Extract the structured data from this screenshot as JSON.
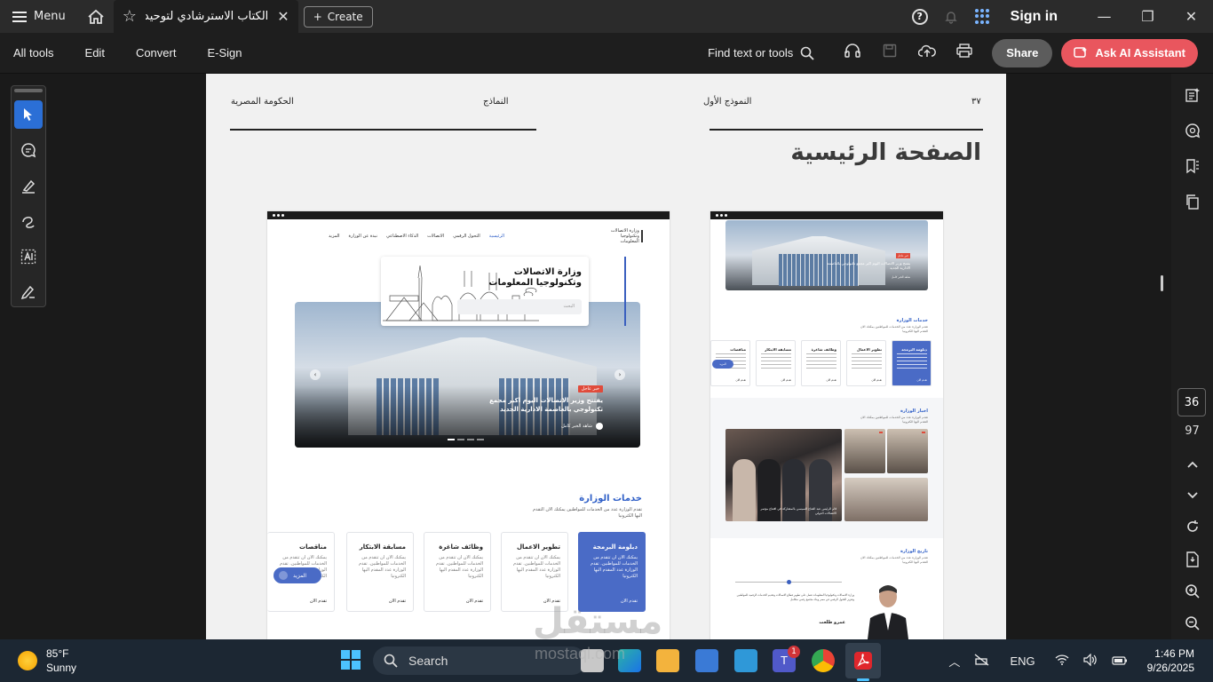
{
  "titlebar": {
    "menu_label": "Menu",
    "tab_title": "الكتاب الاسترشادي لتوحيد ال...",
    "create_label": "Create",
    "help_label": "?",
    "signin_label": "Sign in",
    "minimize": "—",
    "restore": "❐",
    "close": "✕"
  },
  "toolbar": {
    "items": [
      "All tools",
      "Edit",
      "Convert",
      "E-Sign"
    ],
    "find_label": "Find text or tools",
    "share_label": "Share",
    "ai_label": "Ask AI Assistant"
  },
  "document": {
    "header": {
      "page_no": "٣٧",
      "model_label": "النموذج الأول",
      "models_label": "النماذج",
      "gov_label": "الحكومة المصرية"
    },
    "page_title": "الصفحة الرئيسية",
    "mock_a": {
      "nav": [
        "الرئيسية",
        "التحول الرقمي",
        "الاتصالات",
        "الذكاء الاصطناعي",
        "نبذة عن الوزارة",
        "المزيد"
      ],
      "logo_text": "وزارة الاتصالات وتكنولوجيا المعلومات",
      "hero_title_1": "وزارة الاتصالات",
      "hero_title_2": "وتكنولوجيا المعلومات",
      "search_placeholder": "البحث",
      "badge": "خبر عاجل",
      "headline": "يفتتح وزير الاتصالات اليوم اكبر مجمع تكنولوجي بالعاصمة الادارية الجديد",
      "more_link": "شاهد الخبر كامل",
      "services_title": "خدمات الوزارة",
      "services_sub": "تقدم الوزارة عدد من الخدمات للمواطنين يمكنك الان التقدم اليها الكترونيا",
      "services": [
        {
          "title": "دبلومة البرمجة",
          "desc": "يمكنك الان ان تتقدم من الخدمات للمواطنين. تقدم الوزارة عدد المقدم اليها الكترونيا",
          "action": "تقدم الان"
        },
        {
          "title": "تطوير الاعمال",
          "desc": "يمكنك الان ان تتقدم من الخدمات للمواطنين. تقدم الوزارة عدد المقدم اليها الكترونيا",
          "action": "تقدم الان"
        },
        {
          "title": "وظائف شاغرة",
          "desc": "يمكنك الان ان تتقدم من الخدمات للمواطنين. تقدم الوزارة عدد المقدم اليها الكترونيا",
          "action": "تقدم الان"
        },
        {
          "title": "مسابقة الابتكار",
          "desc": "يمكنك الان ان تتقدم من الخدمات للمواطنين. تقدم الوزارة عدد المقدم اليها الكترونيا",
          "action": "تقدم الان"
        },
        {
          "title": "مناقصات",
          "desc": "يمكنك الان ان تتقدم من الخدمات للمواطنين. تقدم الوزارة عدد المقدم اليها الكترونيا",
          "action": "تقدم الان"
        }
      ],
      "more_pill": "المزيد"
    },
    "mock_b": {
      "badge": "خبر عاجل",
      "headline": "يفتتح وزير الاتصالات اليوم اكبر مجمع تكنولوجي بالعاصمة الادارية الجديد",
      "more_link": "شاهد الخبر كامل",
      "services_title": "خدمات الوزارة",
      "services_sub": "تقدم الوزارة عدد من الخدمات للمواطنين يمكنك الان التقدم اليها الكترونيا",
      "services": [
        "دبلومة البرمجة",
        "تطوير الاعمال",
        "وظائف شاغرة",
        "مسابقة الابتكار",
        "مناقصات"
      ],
      "service_action": "تقدم الان",
      "more_pill": "المزيد",
      "news_title": "اخبار الوزارة",
      "news_sub": "تقدم الوزارة عدد من الخدمات للمواطنين يمكنك الان التقدم اليها الكترونيا",
      "news_caption": "قام الرئيس عبد الفتاح السيسي بالمشاركة في افتتاح مؤتمر الاتصالات الدولي",
      "history_title": "تاريخ الوزارة",
      "history_sub": "تقدم الوزارة عدد من الخدمات للمواطنين يمكنك الان التقدم اليها الكترونيا",
      "minister_name": "عمرو طلعت",
      "history_text": "وزارة الاتصالات وتكنولوجيا المعلومات تعمل على تطوير قطاع الاتصالات وتقديم الخدمات الرقمية للمواطنين وتعزيز التحول الرقمي في مصر وبناء مجتمع رقمي متكامل"
    }
  },
  "rightpanel": {
    "current_page": "36",
    "total_pages": "97"
  },
  "taskbar": {
    "temp": "85°F",
    "condition": "Sunny",
    "search_label": "Search",
    "lang": "ENG",
    "time": "1:46 PM",
    "date": "9/26/2025",
    "teams_badge": "1"
  },
  "watermark": {
    "arabic": "مستقل",
    "latin": "mostaql.com"
  },
  "colors": {
    "accent_blue": "#4a6bc6",
    "ai_button": "#e9565e",
    "active_tool": "#2b6fd6"
  }
}
